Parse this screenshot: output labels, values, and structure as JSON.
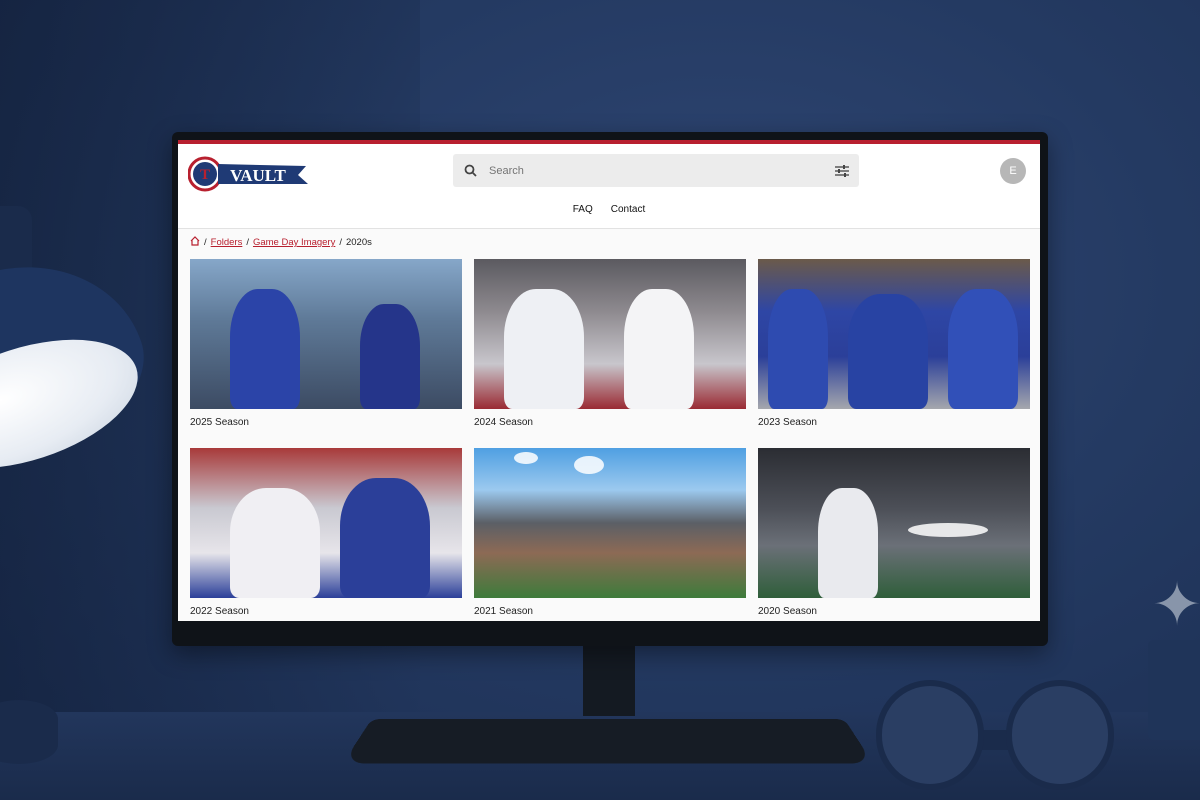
{
  "site": {
    "logo_text": "VAULT",
    "logo_mark": "T",
    "search": {
      "placeholder": "Search"
    },
    "avatar_initial": "E",
    "nav": [
      {
        "label": "FAQ"
      },
      {
        "label": "Contact"
      }
    ],
    "breadcrumb": {
      "separator": "/",
      "items": [
        {
          "label": "Folders"
        },
        {
          "label": "Game Day Imagery"
        }
      ],
      "current": "2020s"
    },
    "folders": [
      {
        "label": "2025 Season"
      },
      {
        "label": "2024 Season"
      },
      {
        "label": "2023 Season"
      },
      {
        "label": "2022 Season"
      },
      {
        "label": "2021 Season"
      },
      {
        "label": "2020 Season"
      }
    ]
  },
  "colors": {
    "brand_red": "#b8202f",
    "brand_navy": "#1f3a75"
  }
}
